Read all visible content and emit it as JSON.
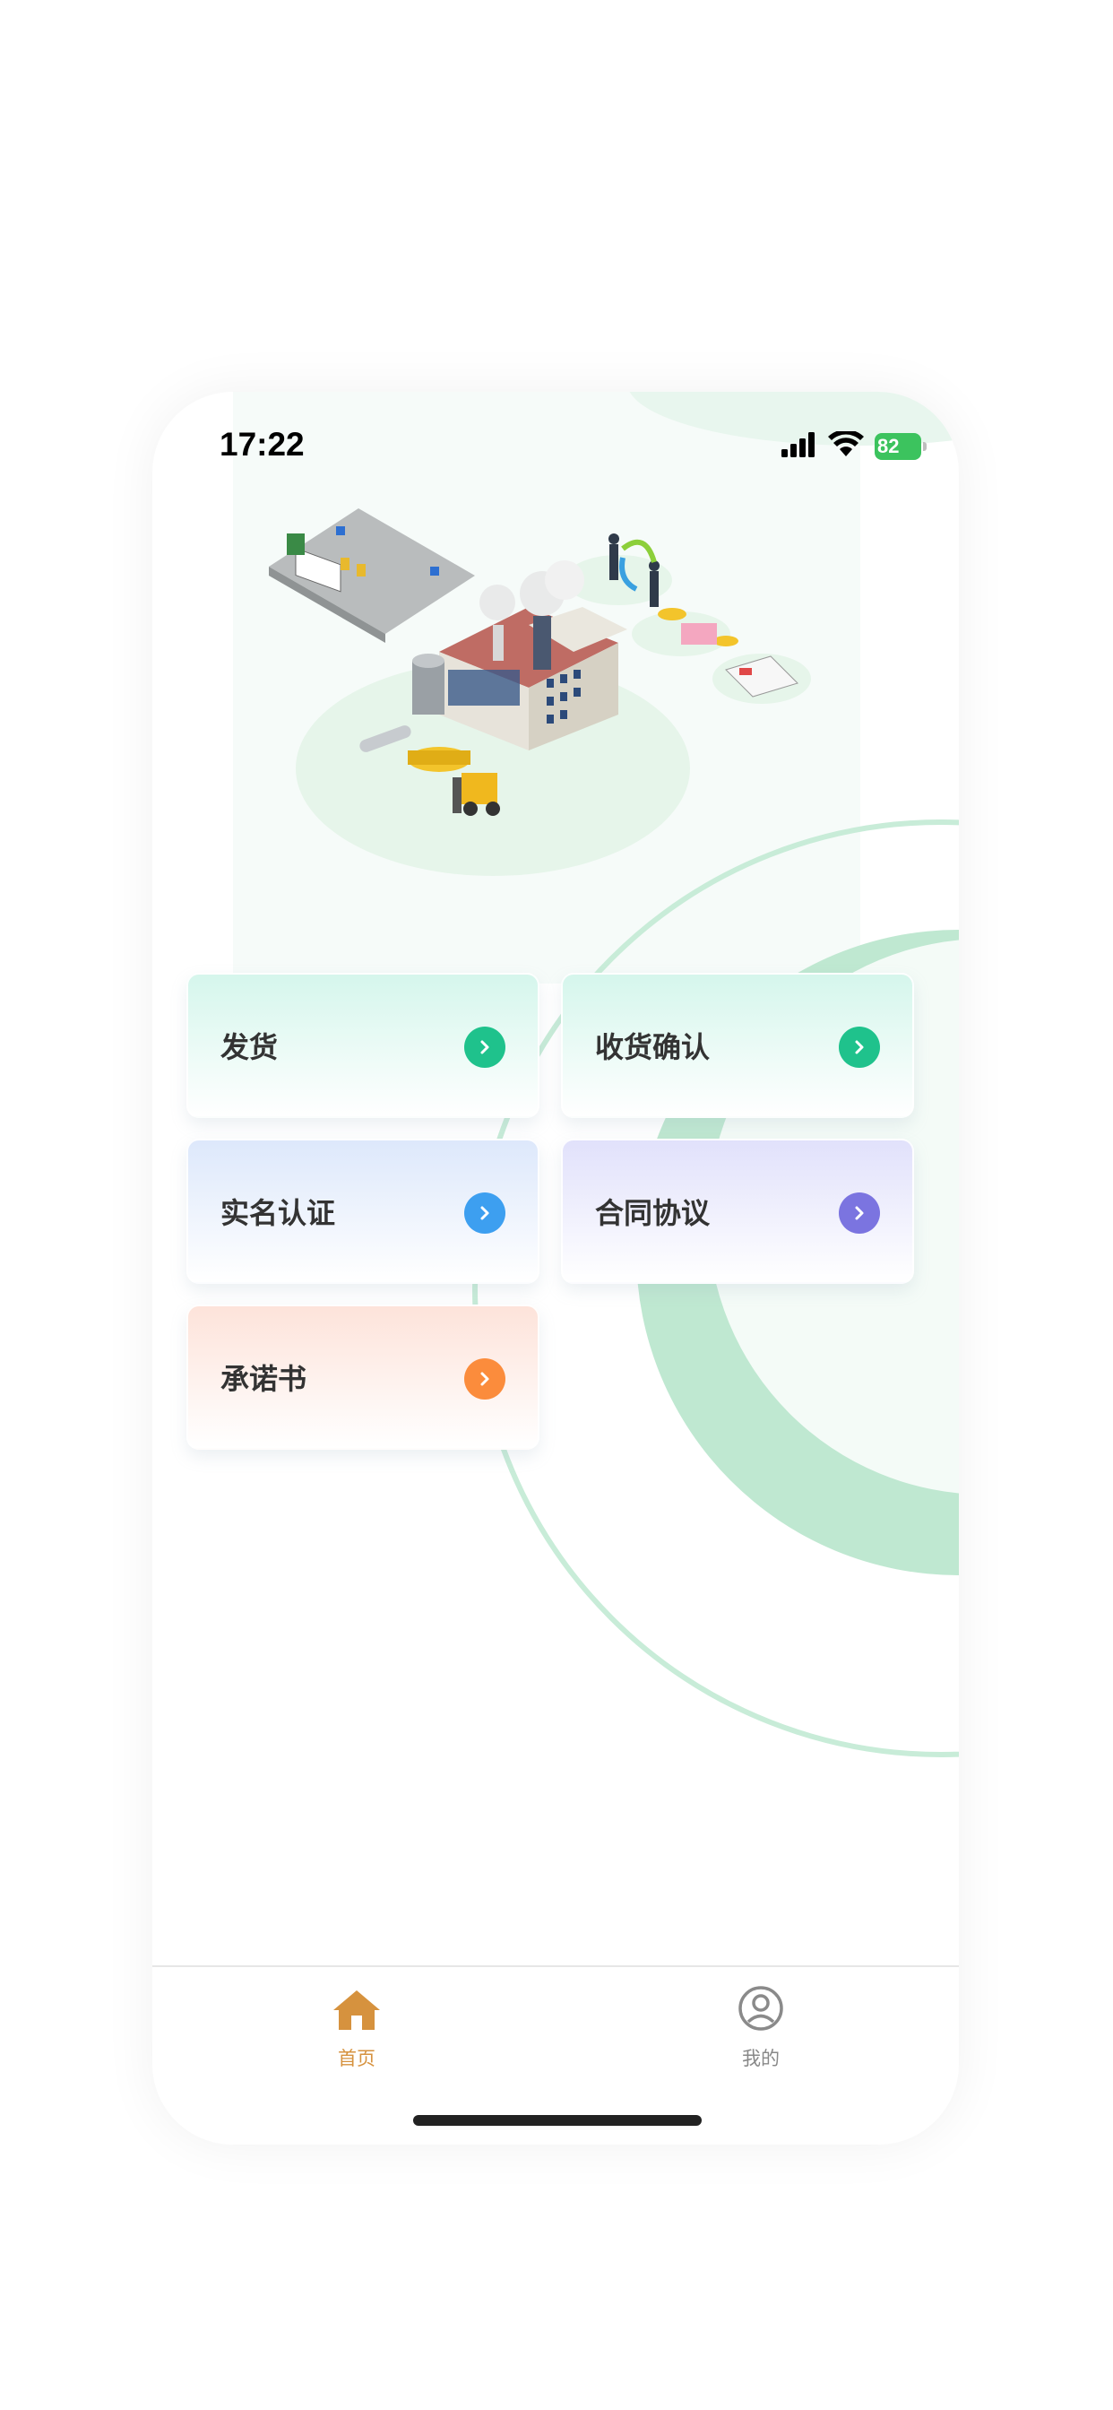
{
  "status_bar": {
    "time": "17:22",
    "battery": "82",
    "icons": [
      "signal-icon",
      "wifi-icon",
      "battery-icon"
    ]
  },
  "hero": {
    "illustration": "factory-logistics-illustration"
  },
  "menu": {
    "items": [
      {
        "label": "发货",
        "accent": "#1fc28c"
      },
      {
        "label": "收货确认",
        "accent": "#1fc28c"
      },
      {
        "label": "实名认证",
        "accent": "#3d9ff0"
      },
      {
        "label": "合同协议",
        "accent": "#7b74e0"
      },
      {
        "label": "承诺书",
        "accent": "#fb8c3c"
      }
    ]
  },
  "tabbar": {
    "items": [
      {
        "label": "首页",
        "icon": "home-icon",
        "active": true,
        "color": "#d6923e"
      },
      {
        "label": "我的",
        "icon": "user-icon",
        "active": false,
        "color": "#888888"
      }
    ]
  }
}
